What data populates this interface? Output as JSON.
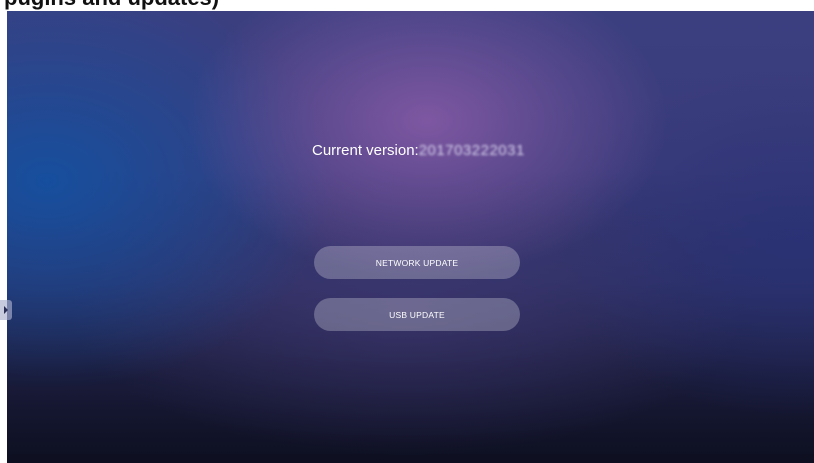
{
  "caption": {
    "text": "pugins and updates)"
  },
  "version": {
    "label": "Current version:",
    "value": "201703222031"
  },
  "buttons": {
    "network_update": "NETWORK UPDATE",
    "usb_update": "USB UPDATE"
  },
  "side_handle": {
    "icon": "chevron-right-icon"
  }
}
